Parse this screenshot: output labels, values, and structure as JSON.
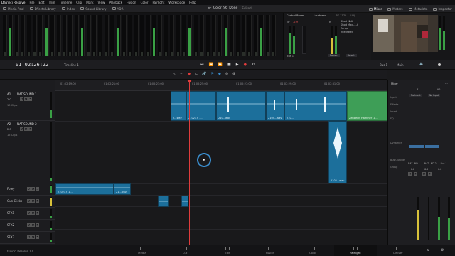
{
  "menu": [
    "DaVinci Resolve",
    "File",
    "Edit",
    "Trim",
    "Timeline",
    "Clip",
    "Mark",
    "View",
    "Playback",
    "Fusion",
    "Color",
    "Fairlight",
    "Workspace",
    "Help"
  ],
  "toolbar": {
    "left": [
      "Media Pool",
      "Effects Library",
      "Index",
      "Sound Library",
      "ADR"
    ],
    "project_title": "SF_Color_S6_Done",
    "project_status": "Edited",
    "right": [
      "Mixer",
      "Meters",
      "Metadata",
      "Inspector"
    ]
  },
  "control_room": {
    "title": "Control Room",
    "loudness": "Loudness",
    "standard": "BS.1770-1 (LU)",
    "tp": "TP",
    "tp_val": "-2.9",
    "m_label": "M",
    "m_val": "-1.0",
    "short": "Short",
    "short_val": "-1.4",
    "short_max": "Short Max",
    "short_max_val": "-1.4",
    "range": "Range",
    "integrated": "Integrated",
    "bus": "Bus 1",
    "pause": "Pause",
    "reset": "Reset"
  },
  "transport": {
    "timecode": "01:02:26:22",
    "timeline": "Timeline 1",
    "bus": "Bus 1",
    "main": "Main"
  },
  "ruler": [
    "01:02:19:00",
    "01:02:21:00",
    "01:02:23:00",
    "01:02:25:00",
    "01:02:27:00",
    "01:02:29:00",
    "01:02:31:00"
  ],
  "tracks": [
    {
      "id": "A1",
      "name": "NAT SOUND 1",
      "val": "2.0",
      "clips": "10 Clips",
      "tc": "01:00:00:00"
    },
    {
      "id": "A2",
      "name": "NAT SOUND 2",
      "val": "2.0",
      "clips": "15 Clips",
      "tc": "01:00:16:22"
    },
    {
      "id": "",
      "name": "Foley",
      "val": "",
      "clips": "",
      "tc": ""
    },
    {
      "id": "",
      "name": "Gun Clicks",
      "val": "",
      "clips": "",
      "tc": ""
    },
    {
      "id": "",
      "name": "SFX1",
      "val": "",
      "clips": "",
      "tc": ""
    },
    {
      "id": "",
      "name": "SFX2",
      "val": "",
      "clips": "",
      "tc": ""
    },
    {
      "id": "",
      "name": "SFX3",
      "val": "",
      "clips": "",
      "tc": ""
    }
  ],
  "clips": {
    "a1": [
      "2...wav",
      "210217_1...",
      "210...wav",
      "2105...wav",
      "210...",
      "Zeppelin_Hammer_1..."
    ],
    "a2": [
      "2105...wav"
    ],
    "foley": [
      "2...",
      "210217_1...",
      "21...wav"
    ]
  },
  "mixer": {
    "title": "Mixer",
    "rows": [
      "Input",
      "Effects",
      "Insert",
      "EQ",
      "Dynamics",
      "Bus Outputs",
      "Group"
    ],
    "col_a1": "A1",
    "col_a2": "A2",
    "input_a1": "No Input",
    "input_a2": "No Input",
    "bottom": [
      "NAT...ND 1",
      "NAT...ND 2",
      "Bus 1"
    ],
    "db": [
      "0.0",
      "0.0",
      "0.0"
    ],
    "bus_output": "Bus 1"
  },
  "pages": [
    "Media",
    "Cut",
    "Edit",
    "Fusion",
    "Color",
    "Fairlight",
    "Deliver"
  ],
  "active_page": "Fairlight",
  "app_name": "DaVinci Resolve 17",
  "colors": {
    "clip_blue": "#1c6f9b",
    "clip_green": "#3e9e57",
    "playhead": "#e03c3c",
    "accent": "#3b8fd0"
  }
}
